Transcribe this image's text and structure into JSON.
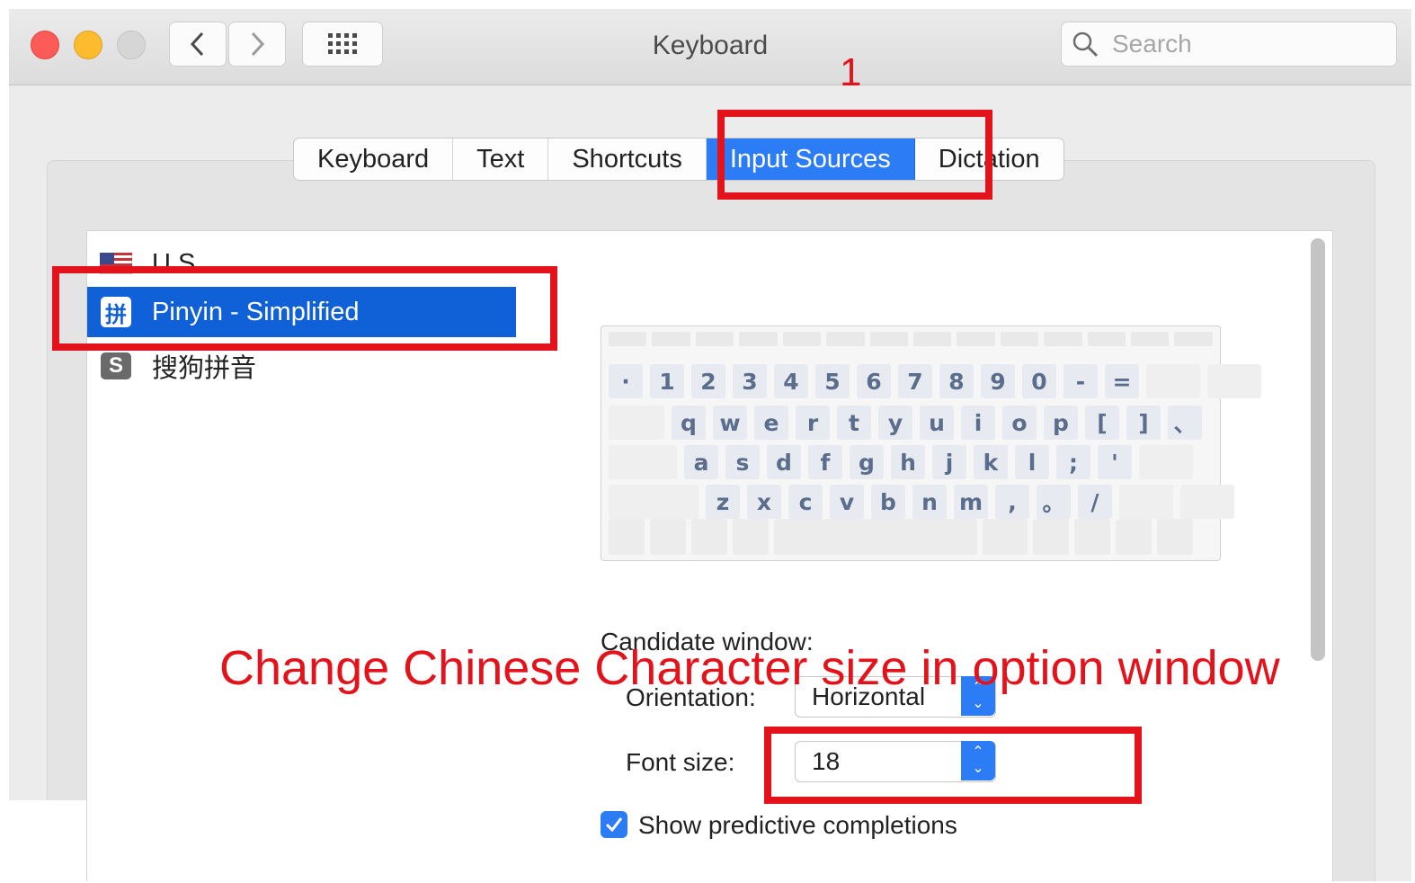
{
  "window": {
    "title": "Keyboard",
    "search_placeholder": "Search"
  },
  "tabs": [
    {
      "label": "Keyboard",
      "active": false
    },
    {
      "label": "Text",
      "active": false
    },
    {
      "label": "Shortcuts",
      "active": false
    },
    {
      "label": "Input Sources",
      "active": true
    },
    {
      "label": "Dictation",
      "active": false
    }
  ],
  "input_sources": [
    {
      "label": "U.S.",
      "icon": "us-flag-icon",
      "selected": false
    },
    {
      "label": "Pinyin - Simplified",
      "icon": "pinyin-icon",
      "icon_glyph": "拼",
      "selected": true
    },
    {
      "label": "搜狗拼音",
      "icon": "sogou-icon",
      "icon_glyph": "S",
      "selected": false
    }
  ],
  "keyboard_rows": [
    [
      "·",
      "1",
      "2",
      "3",
      "4",
      "5",
      "6",
      "7",
      "8",
      "9",
      "0",
      "-",
      "="
    ],
    [
      "q",
      "w",
      "e",
      "r",
      "t",
      "y",
      "u",
      "i",
      "o",
      "p",
      "[",
      "]",
      "、"
    ],
    [
      "a",
      "s",
      "d",
      "f",
      "g",
      "h",
      "j",
      "k",
      "l",
      ";",
      "'"
    ],
    [
      "z",
      "x",
      "c",
      "v",
      "b",
      "n",
      "m",
      ",",
      "。",
      "/"
    ]
  ],
  "settings": {
    "candidate_window_label": "Candidate window:",
    "orientation_label": "Orientation:",
    "orientation_value": "Horizontal",
    "font_size_label": "Font size:",
    "font_size_value": "18",
    "predictive_label": "Show predictive completions",
    "predictive_checked": true
  },
  "annotations": {
    "step_number": "1",
    "instruction": "Change Chinese Character size in option window"
  },
  "colors": {
    "accent": "#2c7cf5",
    "selection": "#1060d8",
    "annotation": "#e3121b"
  }
}
